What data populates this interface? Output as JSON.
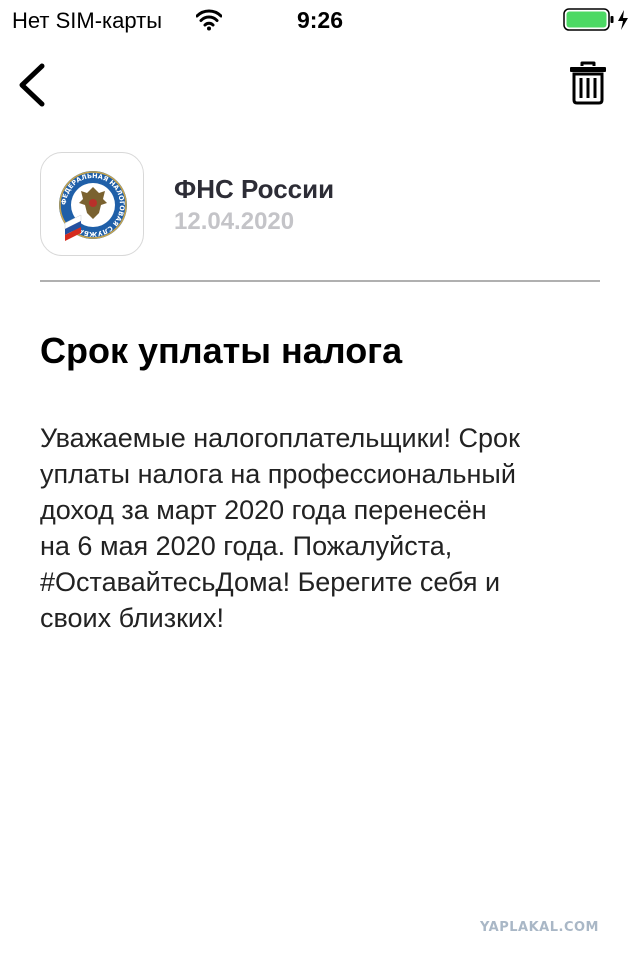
{
  "status_bar": {
    "carrier": "Нет SIM-карты",
    "time": "9:26",
    "battery_level": 1.0,
    "battery_color": "#4cd964",
    "icons": [
      "wifi-icon",
      "battery-icon",
      "charging-bolt-icon"
    ]
  },
  "nav": {
    "back_icon": "chevron-left-icon",
    "delete_icon": "trash-icon"
  },
  "sender": {
    "name": "ФНС России",
    "date": "12.04.2020",
    "logo_text": "ФЕДЕРАЛЬНАЯ НАЛОГОВАЯ СЛУЖБА"
  },
  "message": {
    "title": "Срок уплаты налога",
    "body": "Уважаемые налогоплательщики! Срок\nуплаты налога на профессиональный\nдоход за март 2020 года перенесён\nна 6 мая 2020 года.  Пожалуйста,\n#ОставайтесьДома!  Берегите себя и\nсвоих близких!"
  },
  "watermark": "YAPLAKAL.COM"
}
